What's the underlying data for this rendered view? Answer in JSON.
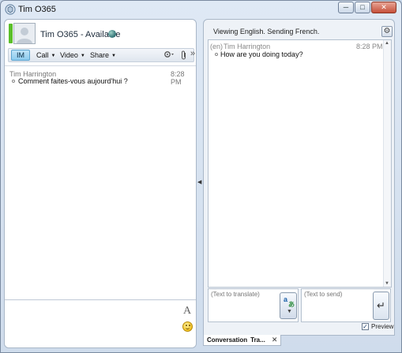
{
  "window": {
    "title": "Tim O365",
    "controls": {
      "minimize": "─",
      "maximize": "□",
      "close": "✕"
    }
  },
  "contact": {
    "name_status": "Tim O365 - Available",
    "presence_color": "#5bbf2a"
  },
  "toolbar": {
    "im_label": "IM",
    "call_label": "Call",
    "video_label": "Video",
    "share_label": "Share",
    "caret": "▼",
    "more": "»"
  },
  "left_conversation": {
    "messages": [
      {
        "sender": "Tim Harrington",
        "time": "8:28 PM",
        "text": "Comment faites-vous aujourd'hui ?"
      }
    ]
  },
  "compose": {
    "font_icon_glyph": "A"
  },
  "translator": {
    "status": "Viewing English. Sending French.",
    "messages": [
      {
        "lang": "(en)",
        "sender": "Tim Harrington",
        "time": "8:28 PM",
        "text": "How are you doing today?"
      }
    ],
    "translate_placeholder": "(Text to translate)",
    "send_placeholder": "(Text to send)",
    "preview_label": "Preview",
    "preview_checked": true,
    "send_glyph": "↵"
  },
  "tabs": {
    "conversation": "Conversation",
    "translator": "Tra...",
    "close": "✕"
  },
  "icons": [
    "logo-icon",
    "avatar",
    "globe-icon",
    "attach-icon",
    "options-icon",
    "gear-icon",
    "font-icon",
    "smiley-icon",
    "translate-icon",
    "send-icon",
    "collapse-arrow-icon"
  ],
  "colors": {
    "accent_im": "#8ccbee",
    "window_bg": "#dfe9f5"
  }
}
